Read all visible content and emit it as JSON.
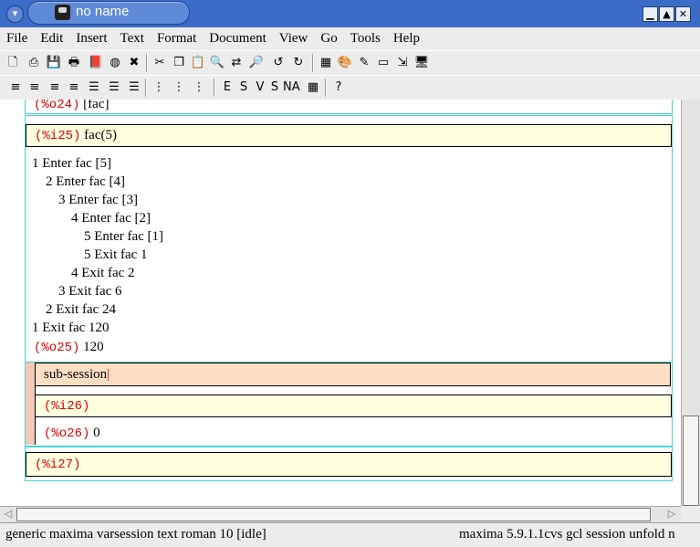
{
  "window": {
    "title": "no name",
    "accent": "#3b6cc8"
  },
  "menubar": [
    "File",
    "Edit",
    "Insert",
    "Text",
    "Format",
    "Document",
    "View",
    "Go",
    "Tools",
    "Help"
  ],
  "toolbar1": [
    {
      "icon": "new-document-icon",
      "glyph": "🗋"
    },
    {
      "icon": "open-icon",
      "glyph": "⎙"
    },
    {
      "icon": "save-icon",
      "glyph": "💾"
    },
    {
      "icon": "print-icon",
      "glyph": "🖶"
    },
    {
      "icon": "book-icon",
      "glyph": "📕"
    },
    {
      "icon": "globe-icon",
      "glyph": "◍"
    },
    {
      "icon": "close-red-x-icon",
      "glyph": "✖"
    },
    {
      "icon": "cut-icon",
      "glyph": "✂"
    },
    {
      "icon": "copy-icon",
      "glyph": "❐"
    },
    {
      "icon": "paste-icon",
      "glyph": "📋"
    },
    {
      "icon": "find-icon",
      "glyph": "🔍"
    },
    {
      "icon": "replace-icon",
      "glyph": "⇄"
    },
    {
      "icon": "zoom-icon",
      "glyph": "🔎"
    },
    {
      "icon": "undo-icon",
      "glyph": "↺"
    },
    {
      "icon": "redo-icon",
      "glyph": "↻"
    },
    {
      "icon": "table-icon",
      "glyph": "▦"
    },
    {
      "icon": "paint-icon",
      "glyph": "🎨"
    },
    {
      "icon": "pencil-icon",
      "glyph": "✎"
    },
    {
      "icon": "frame-icon",
      "glyph": "▭"
    },
    {
      "icon": "transform-icon",
      "glyph": "⇲"
    },
    {
      "icon": "monitor-icon",
      "glyph": "🖥"
    }
  ],
  "toolbar2": [
    {
      "icon": "align-left-icon",
      "glyph": "≡"
    },
    {
      "icon": "align-center-icon",
      "glyph": "≡"
    },
    {
      "icon": "align-right-icon",
      "glyph": "≡"
    },
    {
      "icon": "align-justify-icon",
      "glyph": "≡"
    },
    {
      "icon": "indent-icon",
      "glyph": "☰"
    },
    {
      "icon": "outdent-icon",
      "glyph": "☰"
    },
    {
      "icon": "block-icon",
      "glyph": "☰"
    },
    {
      "icon": "bullet-list-icon",
      "glyph": "⋮"
    },
    {
      "icon": "numbered-list-icon",
      "glyph": "⋮"
    },
    {
      "icon": "description-list-icon",
      "glyph": "⋮"
    },
    {
      "icon": "emphasize-icon",
      "glyph": "E"
    },
    {
      "icon": "strong-icon",
      "glyph": "S"
    },
    {
      "icon": "verbatim-icon",
      "glyph": "V"
    },
    {
      "icon": "sans-serif-icon",
      "glyph": "S"
    },
    {
      "icon": "name-icon",
      "glyph": "NA"
    },
    {
      "icon": "color-palette-icon",
      "glyph": "▦"
    },
    {
      "icon": "help-icon",
      "glyph": "?"
    }
  ],
  "session": {
    "o24_prompt": "(%o24)",
    "o24_value": "[fac]",
    "i25_prompt": "(%i25)",
    "i25_input": "fac(5)",
    "trace": [
      "1 Enter fac [5]",
      "2 Enter fac [4]",
      "3 Enter fac [3]",
      "4 Enter fac [2]",
      "5 Enter fac [1]",
      "5 Exit fac 1",
      "4 Exit fac 2",
      "3 Exit fac 6",
      "2 Exit fac 24",
      "1 Exit fac 120"
    ],
    "o25_prompt": "(%o25)",
    "o25_value": "120",
    "subsession_title": "sub-session",
    "i26_prompt": "(%i26)",
    "o26_prompt": "(%o26)",
    "o26_value": "0",
    "i27_prompt": "(%i27)"
  },
  "statusbar": {
    "left": "generic maxima varsession text roman 10 [idle]",
    "right": "maxima 5.9.1.1cvs gcl session unfold n"
  }
}
